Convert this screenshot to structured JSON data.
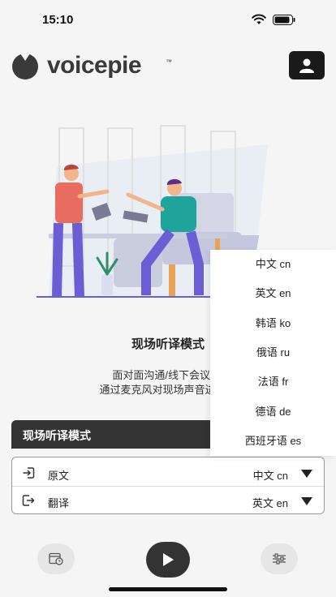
{
  "status_bar": {
    "time": "15:10"
  },
  "brand": {
    "logo_text": "voicepie",
    "trademark": "™"
  },
  "mode": {
    "title": "现场听译模式",
    "desc_line1": "面对面沟通/线下会议/纟",
    "desc_line2": "通过麦克风对现场声音进行记"
  },
  "mode_bar": {
    "label": "现场听译模式"
  },
  "languages": {
    "source": {
      "label": "原文",
      "value": "中文 cn"
    },
    "target": {
      "label": "翻译",
      "value": "英文 en"
    }
  },
  "dropdown": {
    "options": [
      "中文 cn",
      "英文 en",
      "韩语 ko",
      "俄语 ru",
      "法语 fr",
      "德语 de",
      "西班牙语 es"
    ]
  },
  "colors": {
    "dark": "#333333",
    "accent_purple": "#6b5dd3",
    "accent_coral": "#e86c5f",
    "accent_teal": "#1fa39a"
  },
  "icons": {
    "wifi": "wifi-icon",
    "battery": "battery-icon",
    "profile": "user-icon",
    "source": "sign-in-icon",
    "target": "sign-out-icon",
    "caret": "caret-down-icon",
    "history": "history-icon",
    "play": "play-icon",
    "settings": "sliders-icon"
  }
}
